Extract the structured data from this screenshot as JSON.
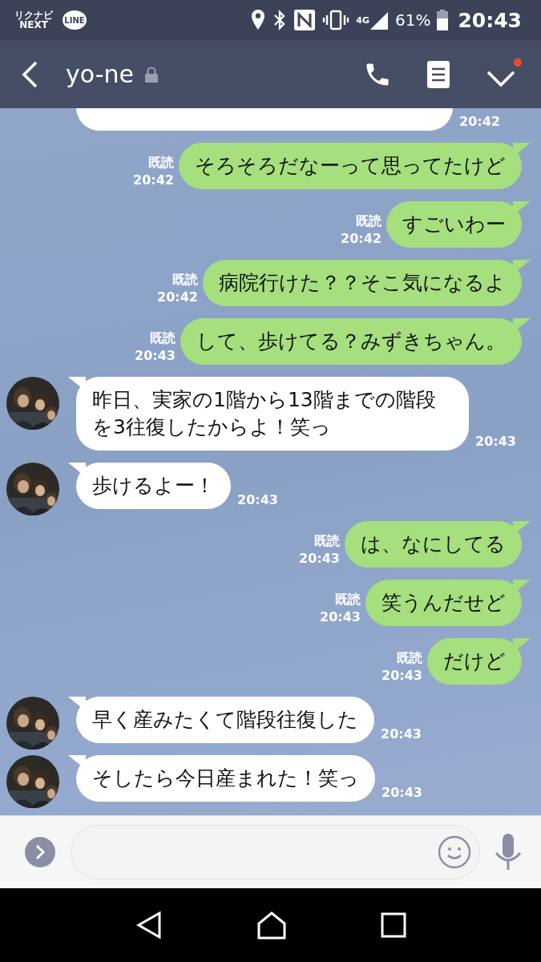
{
  "status_bar": {
    "apps": [
      {
        "kind": "rikunabi",
        "lines": [
          "リクナビ",
          "NEXT"
        ]
      },
      {
        "kind": "line",
        "text": "LINE"
      }
    ],
    "network": "4G",
    "battery": "61%",
    "time": "20:43"
  },
  "header": {
    "title": "yo-ne",
    "locked": true,
    "menu_notification": true
  },
  "messages": [
    {
      "kind": "cut",
      "outgoing": false,
      "time": "20:42"
    },
    {
      "kind": "text",
      "outgoing": true,
      "read": "既読",
      "time": "20:42",
      "text": "そろそろだなーって思ってたけど"
    },
    {
      "kind": "text",
      "outgoing": true,
      "read": "既読",
      "time": "20:42",
      "text": "すごいわー"
    },
    {
      "kind": "text",
      "outgoing": true,
      "read": "既読",
      "time": "20:42",
      "text": "病院行けた？？そこ気になるよ"
    },
    {
      "kind": "text",
      "outgoing": true,
      "read": "既読",
      "time": "20:43",
      "text": "して、歩けてる？みずきちゃん。"
    },
    {
      "kind": "text",
      "outgoing": false,
      "time": "20:43",
      "text": "昨日、実家の1階から13階までの階段を3往復したからよ！笑っ"
    },
    {
      "kind": "text",
      "outgoing": false,
      "time": "20:43",
      "text": "歩けるよー！"
    },
    {
      "kind": "text",
      "outgoing": true,
      "read": "既読",
      "time": "20:43",
      "text": "は、なにしてる"
    },
    {
      "kind": "text",
      "outgoing": true,
      "read": "既読",
      "time": "20:43",
      "text": "笑うんだせど"
    },
    {
      "kind": "text",
      "outgoing": true,
      "read": "既読",
      "time": "20:43",
      "text": "だけど"
    },
    {
      "kind": "text",
      "outgoing": false,
      "time": "20:43",
      "text": "早く産みたくて階段往復した"
    },
    {
      "kind": "text",
      "outgoing": false,
      "time": "20:43",
      "text": "そしたら今日産まれた！笑っ"
    }
  ]
}
